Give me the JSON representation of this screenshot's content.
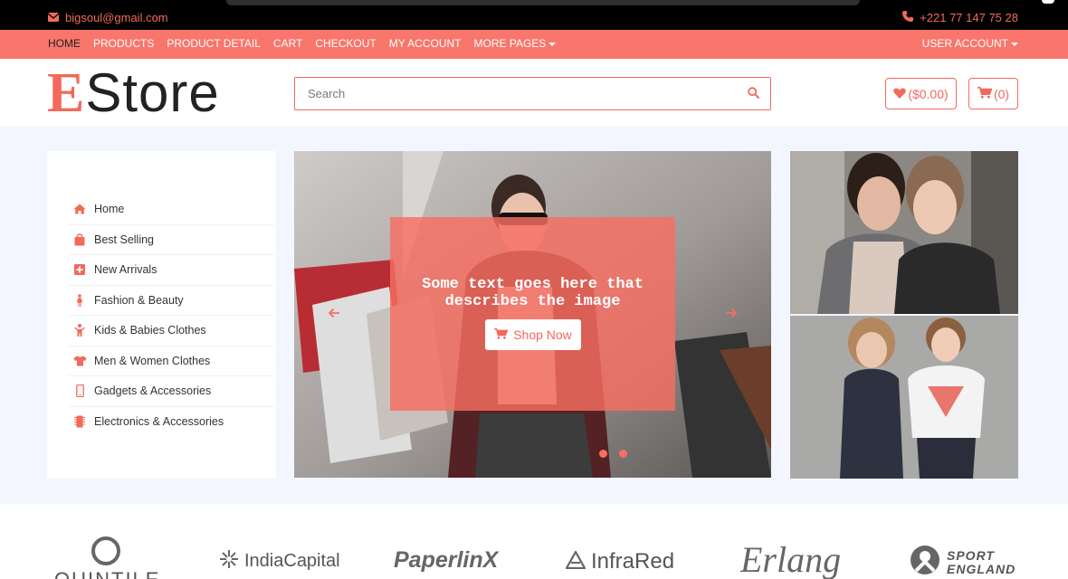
{
  "topbar": {
    "email": "bigsoul@gmail.com",
    "phone": "+221 77 147 75 28",
    "email_icon": "envelope-icon",
    "phone_icon": "phone-icon"
  },
  "nav": {
    "items": [
      {
        "label": "HOME",
        "active": true
      },
      {
        "label": "PRODUCTS"
      },
      {
        "label": "PRODUCT DETAIL"
      },
      {
        "label": "CART"
      },
      {
        "label": "CHECKOUT"
      },
      {
        "label": "MY ACCOUNT"
      },
      {
        "label": "MORE PAGES",
        "dropdown": true
      }
    ],
    "user_account": "USER ACCOUNT"
  },
  "header": {
    "logo_first": "E",
    "logo_rest": "Store",
    "search_placeholder": "Search",
    "wishlist_label": "($0.00)",
    "cart_label": "(0)"
  },
  "sidebar": {
    "items": [
      {
        "label": "Home",
        "icon": "home-icon"
      },
      {
        "label": "Best Selling",
        "icon": "shopping-bag-icon"
      },
      {
        "label": "New Arrivals",
        "icon": "plus-square-icon"
      },
      {
        "label": "Fashion & Beauty",
        "icon": "female-icon"
      },
      {
        "label": "Kids & Babies Clothes",
        "icon": "child-icon"
      },
      {
        "label": "Men & Women Clothes",
        "icon": "tshirt-icon"
      },
      {
        "label": "Gadgets & Accessories",
        "icon": "mobile-icon"
      },
      {
        "label": "Electronics & Accessories",
        "icon": "microchip-icon"
      }
    ]
  },
  "slider": {
    "caption": "Some text goes here that describes the image",
    "button_label": "Shop Now",
    "slide_count": 2
  },
  "brands": [
    {
      "name": "QUINTILES"
    },
    {
      "name": "IndiaCapital"
    },
    {
      "name": "PaperlinX"
    },
    {
      "name": "InfraRed"
    },
    {
      "name": "Erlang"
    },
    {
      "name": "SPORT ENGLAND"
    }
  ],
  "colors": {
    "accent": "#f8766b",
    "accent_text": "#f16a5b",
    "topbar_bg": "#000000",
    "main_bg": "#f3f6ff"
  }
}
